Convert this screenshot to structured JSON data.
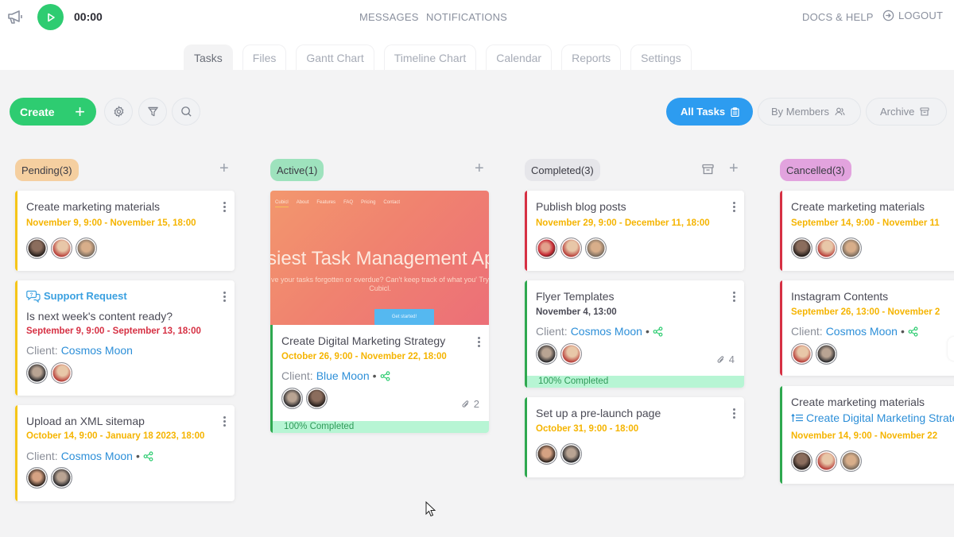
{
  "header": {
    "timer": "00:00",
    "nav": {
      "messages": "MESSAGES",
      "notifications": "NOTIFICATIONS",
      "docs": "DOCS & HELP",
      "logout": "LOGOUT"
    },
    "tabs": [
      {
        "label": "Tasks",
        "active": true
      },
      {
        "label": "Files"
      },
      {
        "label": "Gantt Chart"
      },
      {
        "label": "Timeline Chart"
      },
      {
        "label": "Calendar"
      },
      {
        "label": "Reports"
      },
      {
        "label": "Settings"
      }
    ]
  },
  "toolbar": {
    "create_label": "Create",
    "views": {
      "all_tasks": "All Tasks",
      "by_members": "By Members",
      "archive": "Archive"
    }
  },
  "colors": {
    "green": "#2ecc71",
    "blue": "#2d9cf0",
    "date_yellow": "#f5b400",
    "date_red": "#d63043",
    "pending": "#f5cfa0",
    "active": "#9ee2bd",
    "completed": "#e6e6ea",
    "cancelled": "#e2a3de"
  },
  "columns": {
    "pending": {
      "header": "Pending(3)",
      "cards": [
        {
          "title": "Create marketing materials",
          "date": "November 9, 9:00 - November 15, 18:00"
        },
        {
          "tag": "Support Request",
          "title": "Is next week's content ready?",
          "date": "September 9, 9:00 - September 13, 18:00",
          "client_label": "Client:",
          "client": "Cosmos Moon"
        },
        {
          "title": "Upload an XML sitemap",
          "date": "October 14, 9:00 - January 18 2023, 18:00",
          "client_label": "Client:",
          "client": "Cosmos Moon"
        }
      ]
    },
    "active": {
      "header": "Active(1)",
      "cards": [
        {
          "preview": {
            "nav": [
              "Cubicl",
              "About",
              "Features",
              "FAQ",
              "Pricing",
              "Contact"
            ],
            "headline": "siest Task Management Ap",
            "sub": "ve your tasks forgotten or overdue? Can't keep track of what you' Try Cubicl.",
            "cta": "Get started!"
          },
          "title": "Create Digital Marketing Strategy",
          "date": "October 26, 9:00 - November 22, 18:00",
          "client_label": "Client:",
          "client": "Blue Moon",
          "attachments": "2",
          "progress": "100% Completed",
          "progress_value": 100
        }
      ]
    },
    "completed": {
      "header": "Completed(3)",
      "cards": [
        {
          "title": "Publish blog posts",
          "date": "November 29, 9:00 - December 11, 18:00"
        },
        {
          "title": "Flyer Templates",
          "date": "November 4, 13:00",
          "client_label": "Client:",
          "client": "Cosmos Moon",
          "attachments": "4",
          "progress": "100% Completed",
          "progress_value": 100
        },
        {
          "title": "Set up a pre-launch page",
          "date": "October 31, 9:00 - 18:00"
        }
      ]
    },
    "cancelled": {
      "header": "Cancelled(3)",
      "cards": [
        {
          "title": "Create marketing materials",
          "date": "September 14, 9:00 - November 11"
        },
        {
          "title": "Instagram Contents",
          "date": "September 26, 13:00 - November 2",
          "client_label": "Client:",
          "client": "Cosmos Moon"
        },
        {
          "title": "Create marketing materials",
          "parent": "Create Digital Marketing Strategy",
          "date": "November 14, 9:00 - November 22"
        }
      ]
    }
  }
}
